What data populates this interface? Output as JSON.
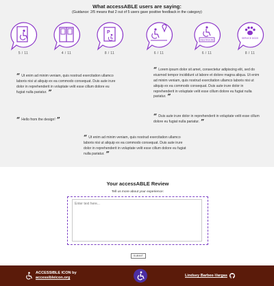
{
  "header": {
    "title": "What accessABLE users are saying:",
    "guidance": "(Guidance: 2/5 means that 2 out of 5 users gave positive feedback in the category)"
  },
  "categories": [
    {
      "icon": "door-accessibility-icon",
      "count": "5 / 11"
    },
    {
      "icon": "double-door-icon",
      "count": "4 / 11"
    },
    {
      "icon": "parking-icon",
      "count": "8 / 11"
    },
    {
      "icon": "location-pin-icon",
      "count": "6 / 11"
    },
    {
      "icon": "restroom-icon",
      "count": "6 / 11",
      "label": "RESTROOM"
    },
    {
      "icon": "service-dog-icon",
      "count": "8 / 11",
      "label": "SERVICE DOGS"
    }
  ],
  "quotes": [
    {
      "open": "“",
      "text": "Ut enim ad minim veniam, quis nostrud exercitation ullamco laboris nisi ut aliquip ex ea commodo consequat. Duis aute irure dolor in reprehenderit in voluptate velit esse cillum dolore eu fugiat nulla pariatur.",
      "close": "”"
    },
    {
      "open": "“",
      "text": "Lorem ipsum dolor sit amet, consectetur adipiscing elit, sed do eiusmod tempor incididunt ut labore et dolore magna aliqua. Ut enim ad minim veniam, quis nostrud exercitation ullamco laboris nisi ut aliquip ex ea commodo consequat. Duis aute irure dolor in reprehenderit in voluptate velit esse cillum dolore eu fugiat nulla pariatur.",
      "close": "”"
    },
    {
      "open": "“",
      "text": "Hello from the design!",
      "close": "”"
    },
    {
      "open": "“",
      "text": "Duis aute irure dolor in reprehenderit in voluptate velit esse cillum dolore eu fugiat nulla pariatur.",
      "close": "”"
    },
    {
      "open": "“",
      "text": "Ut enim ad minim veniam, quis nostrud exercitation ullamco laboris nisi ut aliquip ex ea commodo consequat. Duis aute irure dolor in reprehenderit in voluptate velit esse cillum dolore eu fugiat nulla pariatur.",
      "close": "”"
    }
  ],
  "review": {
    "title": "Your accessABLE Review",
    "subtitle": "Tell us more about your experience:",
    "placeholder": "Enter text here...",
    "submit_label": "SUBMIT"
  },
  "footer": {
    "brand_line1": "ACCESSIBLE ICON by",
    "brand_line2": "accessibleicon.org",
    "author": "Lindsey Barbee-Vargas"
  },
  "colors": {
    "accent": "#8b35c9",
    "dash_border": "#7b3fc4",
    "footer_bg": "#5b1b0a",
    "logo_bg": "#4c2ea3",
    "top_bg": "#f1f1f1"
  }
}
